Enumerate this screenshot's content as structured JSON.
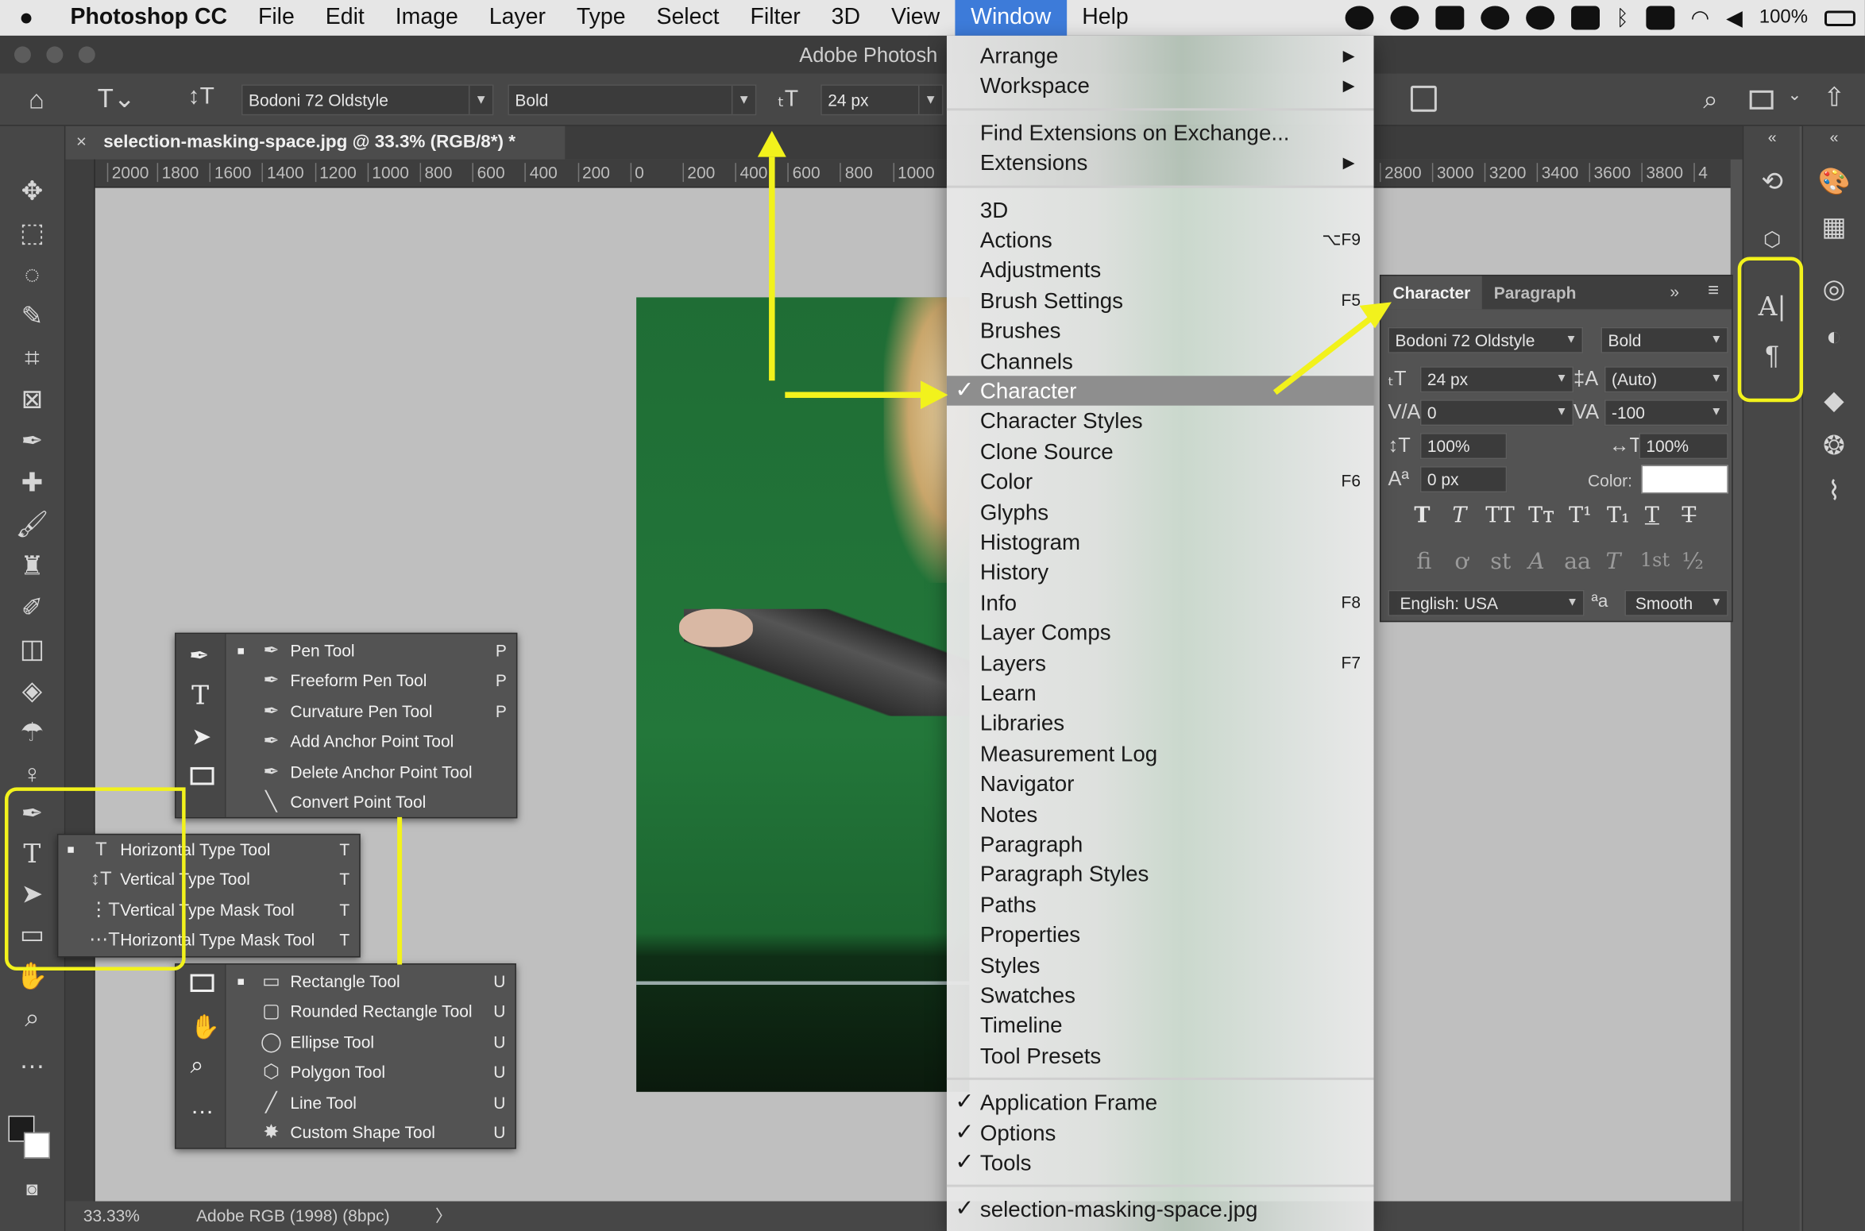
{
  "macbar": {
    "app": "Photoshop CC",
    "menus": [
      "File",
      "Edit",
      "Image",
      "Layer",
      "Type",
      "Select",
      "Filter",
      "3D",
      "View",
      "Window",
      "Help"
    ],
    "battery": "100%"
  },
  "window_title": "Adobe Photosh",
  "options": {
    "font_family": "Bodoni 72 Oldstyle",
    "font_style": "Bold",
    "font_size": "24 px"
  },
  "document": {
    "tab_title": "selection-masking-space.jpg @ 33.3% (RGB/8*) *",
    "zoom": "33.33%",
    "profile": "Adobe RGB (1998) (8bpc)"
  },
  "ruler": {
    "left_ticks": [
      "2000",
      "1800",
      "1600",
      "1400",
      "1200",
      "1000",
      "800",
      "600",
      "400",
      "200",
      "0",
      "200",
      "400",
      "600",
      "800",
      "1000"
    ],
    "right_ticks": [
      "2800",
      "3000",
      "3200",
      "3400",
      "3600",
      "3800",
      "4"
    ]
  },
  "pen_flyout": [
    {
      "label": "Pen Tool",
      "key": "P",
      "icon": "pen-icon"
    },
    {
      "label": "Freeform Pen Tool",
      "key": "P",
      "icon": "freeform-pen-icon"
    },
    {
      "label": "Curvature Pen Tool",
      "key": "P",
      "icon": "curvature-pen-icon"
    },
    {
      "label": "Add Anchor Point Tool",
      "key": "",
      "icon": "add-anchor-icon"
    },
    {
      "label": "Delete Anchor Point Tool",
      "key": "",
      "icon": "delete-anchor-icon"
    },
    {
      "label": "Convert Point Tool",
      "key": "",
      "icon": "convert-point-icon"
    }
  ],
  "type_flyout": [
    {
      "label": "Horizontal Type Tool",
      "key": "T",
      "icon": "horizontal-type-icon"
    },
    {
      "label": "Vertical Type Tool",
      "key": "T",
      "icon": "vertical-type-icon"
    },
    {
      "label": "Vertical Type Mask Tool",
      "key": "T",
      "icon": "vertical-type-mask-icon"
    },
    {
      "label": "Horizontal Type Mask Tool",
      "key": "T",
      "icon": "horizontal-type-mask-icon"
    }
  ],
  "shape_flyout": [
    {
      "label": "Rectangle Tool",
      "key": "U",
      "icon": "rectangle-icon"
    },
    {
      "label": "Rounded Rectangle Tool",
      "key": "U",
      "icon": "rounded-rectangle-icon"
    },
    {
      "label": "Ellipse Tool",
      "key": "U",
      "icon": "ellipse-icon"
    },
    {
      "label": "Polygon Tool",
      "key": "U",
      "icon": "polygon-icon"
    },
    {
      "label": "Line Tool",
      "key": "U",
      "icon": "line-icon"
    },
    {
      "label": "Custom Shape Tool",
      "key": "U",
      "icon": "custom-shape-icon"
    }
  ],
  "window_menu": {
    "group1": [
      {
        "label": "Arrange",
        "submenu": true
      },
      {
        "label": "Workspace",
        "submenu": true
      }
    ],
    "group2": [
      {
        "label": "Find Extensions on Exchange...",
        "submenu": false
      },
      {
        "label": "Extensions",
        "submenu": true
      }
    ],
    "group3": [
      {
        "label": "3D",
        "shortcut": ""
      },
      {
        "label": "Actions",
        "shortcut": "⌥F9"
      },
      {
        "label": "Adjustments",
        "shortcut": ""
      },
      {
        "label": "Brush Settings",
        "shortcut": "F5"
      },
      {
        "label": "Brushes",
        "shortcut": ""
      },
      {
        "label": "Channels",
        "shortcut": ""
      },
      {
        "label": "Character",
        "shortcut": "",
        "checked": true,
        "highlighted": true
      },
      {
        "label": "Character Styles",
        "shortcut": ""
      },
      {
        "label": "Clone Source",
        "shortcut": ""
      },
      {
        "label": "Color",
        "shortcut": "F6"
      },
      {
        "label": "Glyphs",
        "shortcut": ""
      },
      {
        "label": "Histogram",
        "shortcut": ""
      },
      {
        "label": "History",
        "shortcut": ""
      },
      {
        "label": "Info",
        "shortcut": "F8"
      },
      {
        "label": "Layer Comps",
        "shortcut": ""
      },
      {
        "label": "Layers",
        "shortcut": "F7"
      },
      {
        "label": "Learn",
        "shortcut": ""
      },
      {
        "label": "Libraries",
        "shortcut": ""
      },
      {
        "label": "Measurement Log",
        "shortcut": ""
      },
      {
        "label": "Navigator",
        "shortcut": ""
      },
      {
        "label": "Notes",
        "shortcut": ""
      },
      {
        "label": "Paragraph",
        "shortcut": ""
      },
      {
        "label": "Paragraph Styles",
        "shortcut": ""
      },
      {
        "label": "Paths",
        "shortcut": ""
      },
      {
        "label": "Properties",
        "shortcut": ""
      },
      {
        "label": "Styles",
        "shortcut": ""
      },
      {
        "label": "Swatches",
        "shortcut": ""
      },
      {
        "label": "Timeline",
        "shortcut": ""
      },
      {
        "label": "Tool Presets",
        "shortcut": ""
      }
    ],
    "group4": [
      {
        "label": "Application Frame",
        "checked": true
      },
      {
        "label": "Options",
        "checked": true
      },
      {
        "label": "Tools",
        "checked": true
      }
    ],
    "group5": [
      {
        "label": "selection-masking-space.jpg",
        "checked": true
      }
    ]
  },
  "character_panel": {
    "tab_character": "Character",
    "tab_paragraph": "Paragraph",
    "font_family": "Bodoni 72 Oldstyle",
    "font_style": "Bold",
    "size": "24 px",
    "leading": "(Auto)",
    "kerning": "0",
    "tracking": "-100",
    "vertical_scale": "100%",
    "horizontal_scale": "100%",
    "baseline_shift": "0 px",
    "color_label": "Color:",
    "color": "#ffffff",
    "language": "English: USA",
    "antialias": "Smooth",
    "style_buttons": [
      "T",
      "T",
      "TT",
      "Tт",
      "T¹",
      "T₁",
      "T",
      "T"
    ],
    "opentype_buttons": [
      "fi",
      "ơ",
      "st",
      "A",
      "aa",
      "T",
      "1st",
      "½"
    ]
  },
  "colors": {
    "highlight": "#f2f21c",
    "menu_selected": "#8e8e8e",
    "menubar_active": "#3d7bd9"
  }
}
